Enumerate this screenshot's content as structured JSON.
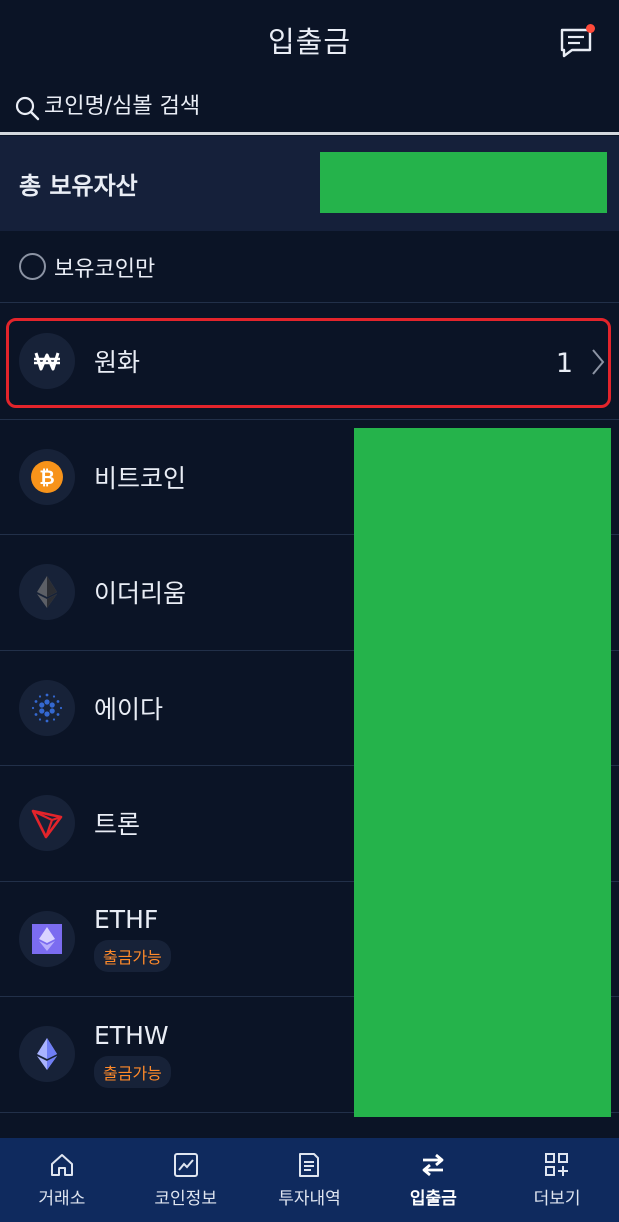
{
  "header": {
    "title": "입출금",
    "notification_icon": "message-list-icon"
  },
  "search": {
    "placeholder": "코인명/심볼 검색"
  },
  "total_assets": {
    "label": "총 보유자산"
  },
  "filter": {
    "label": "보유코인만",
    "checked": false
  },
  "coins": [
    {
      "name": "원화",
      "icon": "won-icon",
      "amount": "1"
    },
    {
      "name": "비트코인",
      "icon": "bitcoin-icon"
    },
    {
      "name": "이더리움",
      "icon": "ethereum-icon"
    },
    {
      "name": "에이다",
      "icon": "cardano-icon"
    },
    {
      "name": "트론",
      "icon": "tron-icon"
    },
    {
      "name": "ETHF",
      "icon": "ethf-icon",
      "badge": "출금가능"
    },
    {
      "name": "ETHW",
      "icon": "ethw-icon",
      "badge": "출금가능"
    }
  ],
  "bottom_nav": [
    {
      "label": "거래소",
      "icon": "home-icon"
    },
    {
      "label": "코인정보",
      "icon": "chart-icon"
    },
    {
      "label": "투자내역",
      "icon": "document-icon"
    },
    {
      "label": "입출금",
      "icon": "transfer-icon",
      "active": true
    },
    {
      "label": "더보기",
      "icon": "grid-plus-icon"
    }
  ],
  "colors": {
    "background": "#0b1426",
    "accent_orange": "#ff8a2a",
    "nav_bg": "#0f2a5e",
    "highlight_red": "#e3242b"
  }
}
